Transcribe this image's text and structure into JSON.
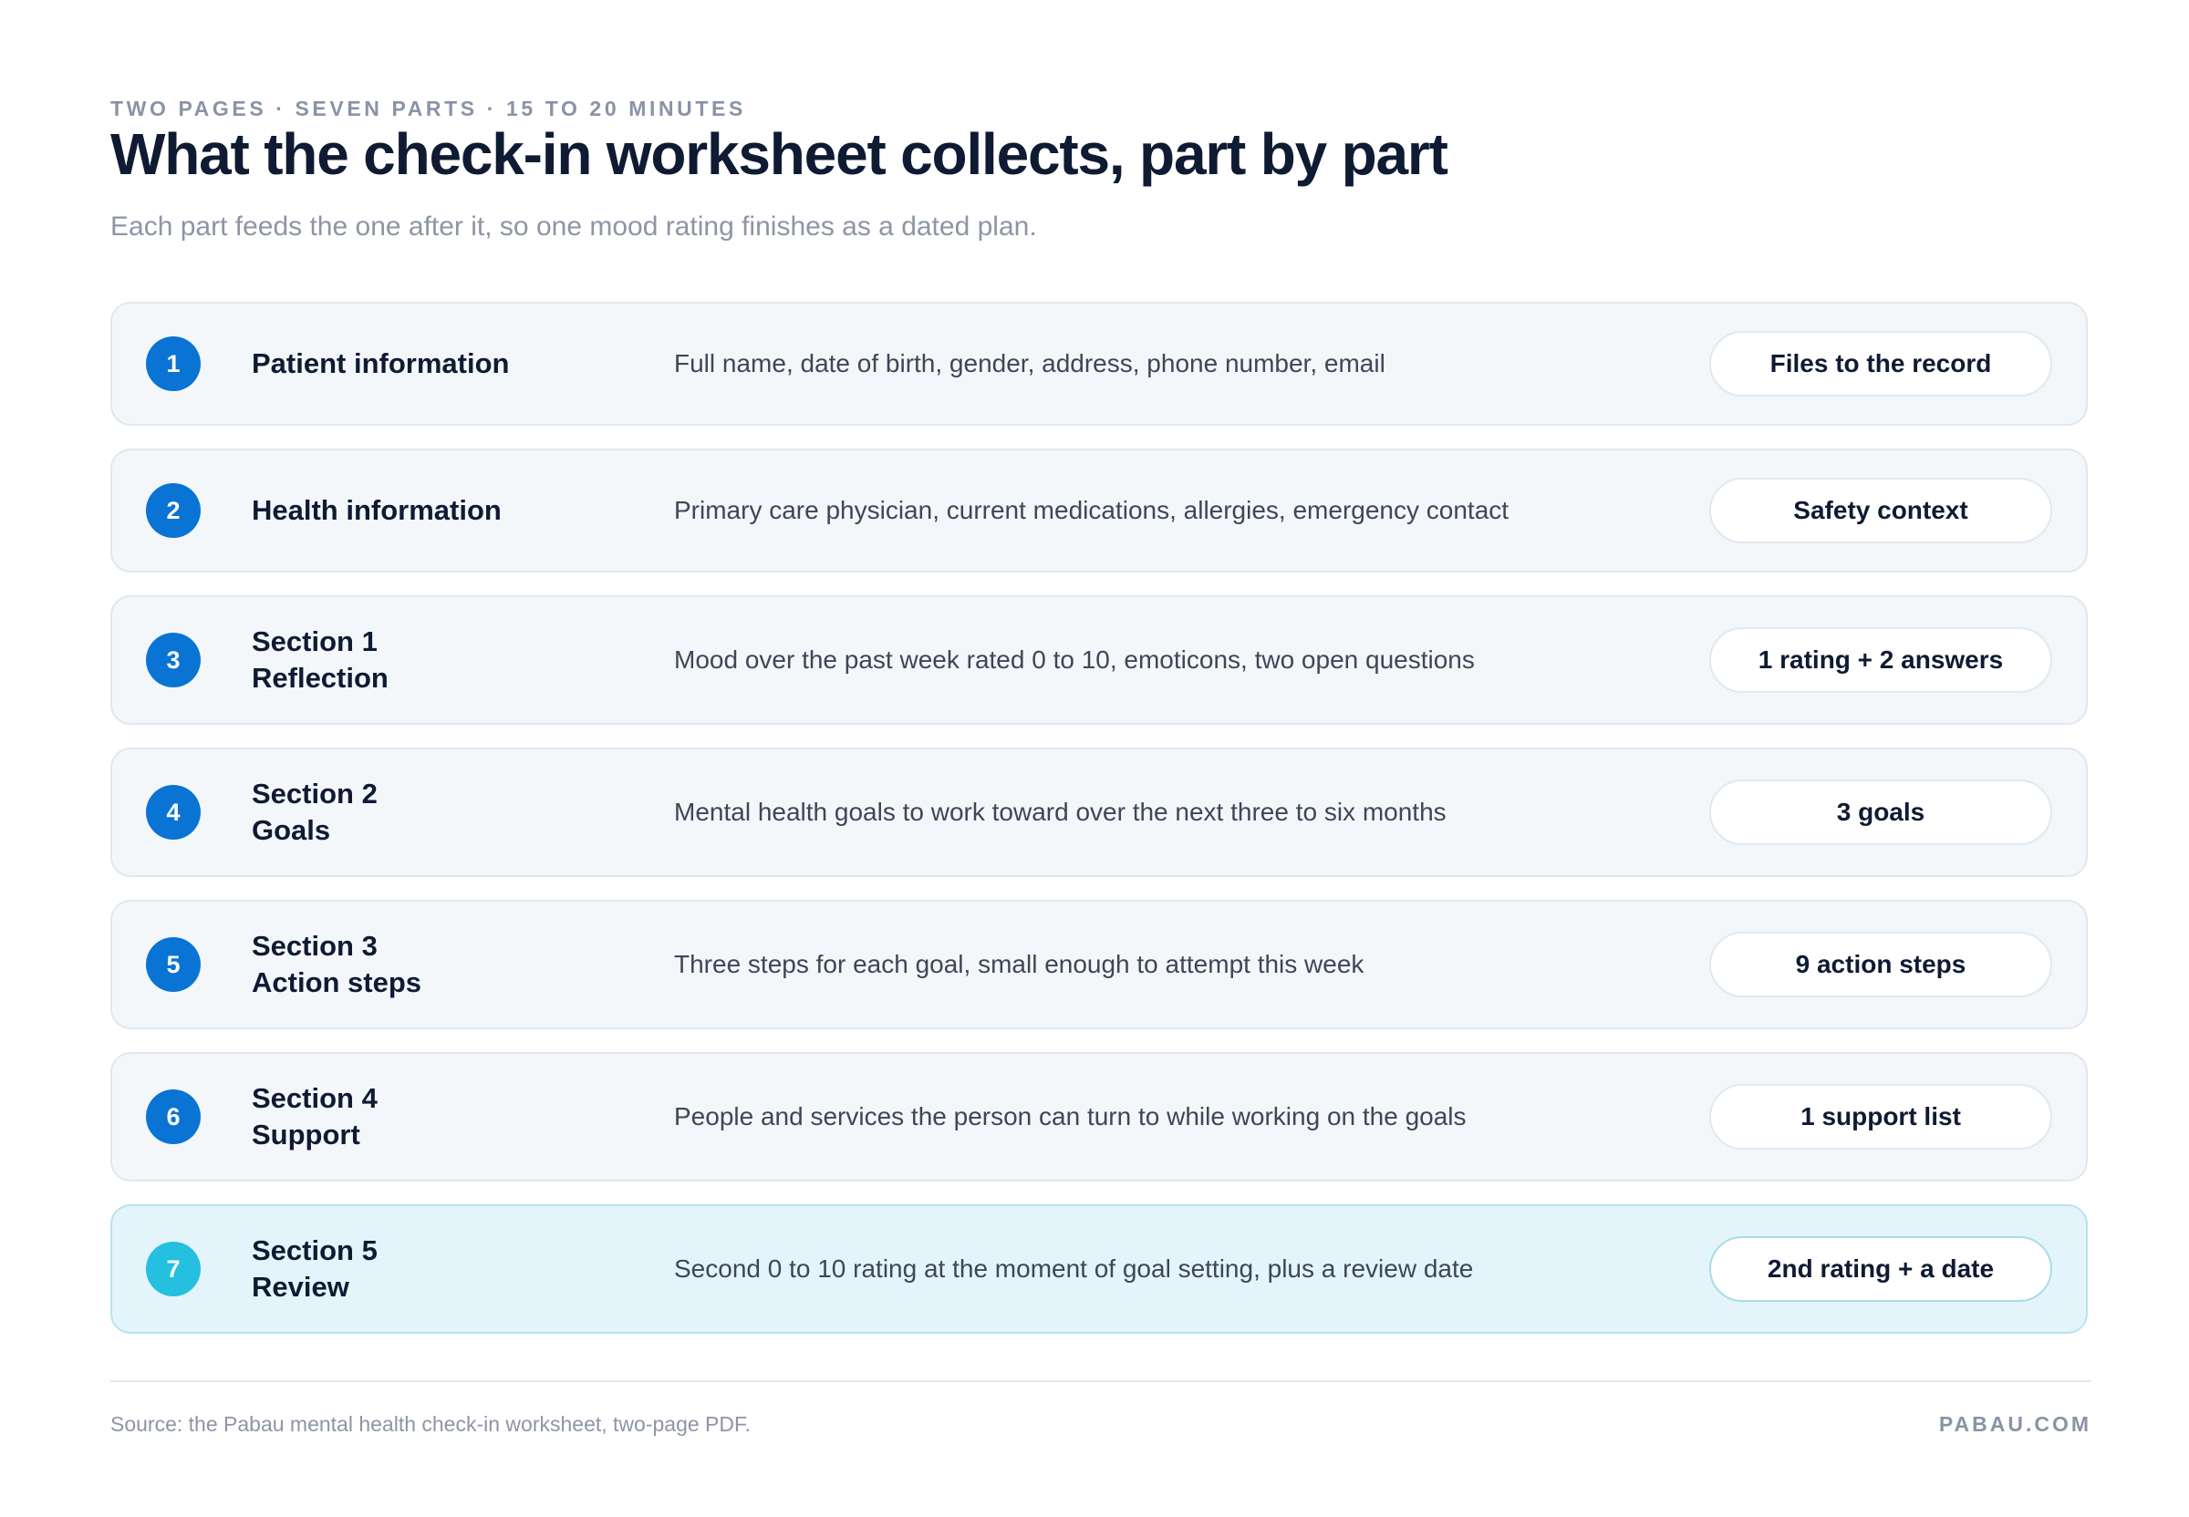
{
  "header": {
    "eyebrow": "TWO PAGES · SEVEN PARTS · 15 TO 20 MINUTES",
    "title": "What the check-in worksheet collects, part by part",
    "subtitle": "Each part feeds the one after it, so one mood rating finishes as a dated plan."
  },
  "parts": [
    {
      "number": "1",
      "label_line1": "Patient information",
      "label_line2": "",
      "description": "Full name, date of birth, gender, address, phone number, email",
      "output": "Files to the record",
      "highlight": false
    },
    {
      "number": "2",
      "label_line1": "Health information",
      "label_line2": "",
      "description": "Primary care physician, current medications, allergies, emergency contact",
      "output": "Safety context",
      "highlight": false
    },
    {
      "number": "3",
      "label_line1": "Section 1",
      "label_line2": "Reflection",
      "description": "Mood over the past week rated 0 to 10, emoticons, two open questions",
      "output": "1 rating + 2 answers",
      "highlight": false
    },
    {
      "number": "4",
      "label_line1": "Section 2",
      "label_line2": "Goals",
      "description": "Mental health goals to work toward over the next three to six months",
      "output": "3 goals",
      "highlight": false
    },
    {
      "number": "5",
      "label_line1": "Section 3",
      "label_line2": "Action steps",
      "description": "Three steps for each goal, small enough to attempt this week",
      "output": "9 action steps",
      "highlight": false
    },
    {
      "number": "6",
      "label_line1": "Section 4",
      "label_line2": "Support",
      "description": "People and services the person can turn to while working on the goals",
      "output": "1 support list",
      "highlight": false
    },
    {
      "number": "7",
      "label_line1": "Section 5",
      "label_line2": "Review",
      "description": "Second 0 to 10 rating at the moment of goal setting, plus a review date",
      "output": "2nd rating + a date",
      "highlight": true
    }
  ],
  "footer": {
    "source": "Source: the Pabau mental health check-in worksheet, two-page PDF.",
    "brand": "PABAU.COM"
  },
  "colors": {
    "accent": "#0a74d4",
    "highlight_accent": "#25bfe0",
    "row_background": "#f3f7fa",
    "highlight_background": "#e3f5fa",
    "text": "#0f1b33",
    "muted": "#8d95a5"
  }
}
